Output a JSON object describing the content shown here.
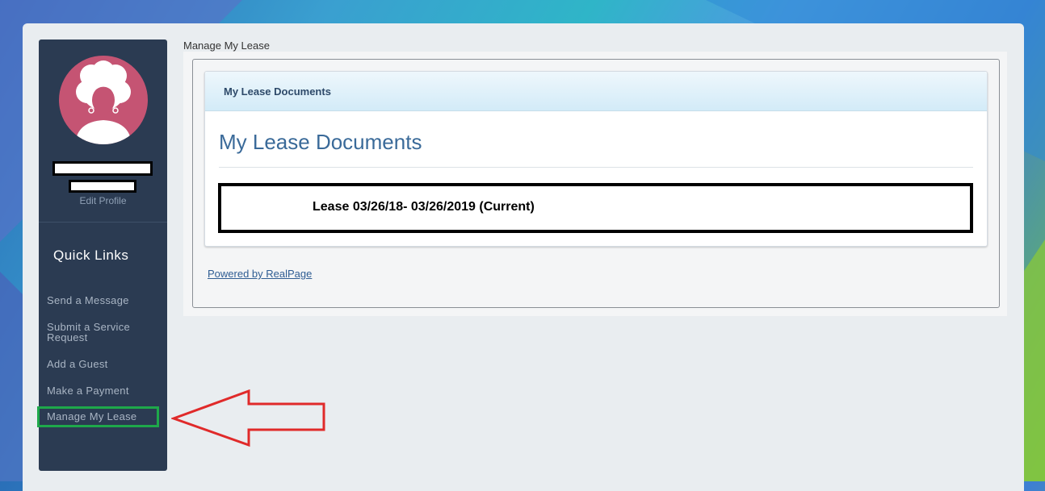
{
  "sidebar": {
    "edit_profile": "Edit Profile",
    "quick_links_title": "Quick Links",
    "items": [
      {
        "label": "Send a Message"
      },
      {
        "label": "Submit a Service Request"
      },
      {
        "label": "Add a Guest"
      },
      {
        "label": "Make a Payment"
      },
      {
        "label": "Manage My Lease"
      }
    ],
    "active_item": "Manage My Lease"
  },
  "breadcrumb": "Manage My Lease",
  "main": {
    "card_header": "My Lease Documents",
    "card_title": "My Lease Documents",
    "lease_link": "Lease 03/26/18- 03/26/2019 (Current)",
    "footer_link": "Powered by RealPage"
  },
  "colors": {
    "sidebar_bg": "#2b3b52",
    "avatar_bg": "#c55473",
    "highlight_box": "#1ea84a",
    "annotation_arrow": "#e02a2a",
    "title_blue": "#3a6a99"
  },
  "icons": {
    "avatar": "user-avatar-icon",
    "annotation": "red-arrow-annotation"
  }
}
